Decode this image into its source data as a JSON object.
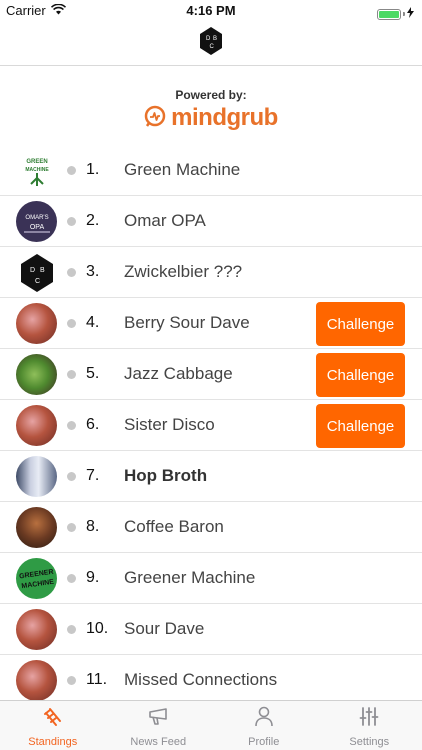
{
  "status_bar": {
    "carrier": "Carrier",
    "time": "4:16 PM"
  },
  "header": {
    "logo_letters": [
      "D",
      "B",
      "C"
    ]
  },
  "powered_by": {
    "label": "Powered by:",
    "brand": "mindgrub"
  },
  "standings": [
    {
      "rank": "1.",
      "name": "Green Machine",
      "avatar_icon": "green-machine-logo",
      "avatar_text": "GREEN MACHINE",
      "challenge": false,
      "bold": false
    },
    {
      "rank": "2.",
      "name": "Omar OPA",
      "avatar_icon": "omars-opa-logo",
      "avatar_text": "OMAR'S OPA",
      "challenge": false,
      "bold": false
    },
    {
      "rank": "3.",
      "name": "Zwickelbier ???",
      "avatar_icon": "dbc-shield-logo",
      "avatar_text": "D B C",
      "challenge": false,
      "bold": false
    },
    {
      "rank": "4.",
      "name": "Berry Sour Dave",
      "avatar_icon": "beer-glass-photo",
      "challenge": true,
      "bold": false
    },
    {
      "rank": "5.",
      "name": "Jazz Cabbage",
      "avatar_icon": "cabbage-photo",
      "challenge": true,
      "bold": false
    },
    {
      "rank": "6.",
      "name": "Sister Disco",
      "avatar_icon": "beer-glass-photo",
      "challenge": true,
      "bold": false
    },
    {
      "rank": "7.",
      "name": "Hop Broth",
      "avatar_icon": "beer-can-photo",
      "challenge": false,
      "bold": true
    },
    {
      "rank": "8.",
      "name": "Coffee Baron",
      "avatar_icon": "dark-beer-photo",
      "challenge": false,
      "bold": false
    },
    {
      "rank": "9.",
      "name": "Greener Machine",
      "avatar_icon": "greener-machine-logo",
      "avatar_text": "GREENER MACHINE",
      "challenge": false,
      "bold": false
    },
    {
      "rank": "10.",
      "name": "Sour Dave",
      "avatar_icon": "beer-glass-photo",
      "challenge": false,
      "bold": false
    },
    {
      "rank": "11.",
      "name": "Missed Connections",
      "avatar_icon": "beer-glass-photo",
      "challenge": false,
      "bold": false
    }
  ],
  "challenge_label": "Challenge",
  "tabs": [
    {
      "label": "Standings",
      "icon": "ladder-icon",
      "active": true
    },
    {
      "label": "News Feed",
      "icon": "megaphone-icon",
      "active": false
    },
    {
      "label": "Profile",
      "icon": "person-icon",
      "active": false
    },
    {
      "label": "Settings",
      "icon": "sliders-icon",
      "active": false
    }
  ],
  "colors": {
    "accent": "#ff6600",
    "tab_active": "#f26522",
    "brand": "#e8722a",
    "battery": "#4cd964"
  }
}
